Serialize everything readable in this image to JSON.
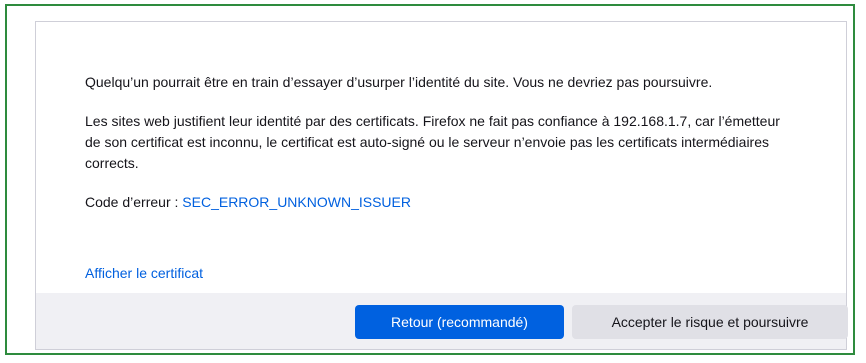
{
  "message": {
    "warning": "Quelqu’un pourrait être en train d’essayer d’usurper l’identité du site. Vous ne devriez pas poursuivre.",
    "explanation": "Les sites web justifient leur identité par des certificats. Firefox ne fait pas confiance à 192.168.1.7, car l’émetteur de son certificat est inconnu, le certificat est auto-signé ou le serveur n’envoie pas les certificats intermédiaires corrects.",
    "error_code_label": "Code d’erreur : ",
    "error_code": "SEC_ERROR_UNKNOWN_ISSUER"
  },
  "links": {
    "view_certificate": "Afficher le certificat"
  },
  "buttons": {
    "go_back": "Retour (recommandé)",
    "accept_risk": "Accepter le risque et poursuivre"
  },
  "colors": {
    "frame_border": "#2e8b3e",
    "link": "#0060df",
    "primary_button": "#0061e0",
    "footer_background": "#f0f0f4"
  }
}
